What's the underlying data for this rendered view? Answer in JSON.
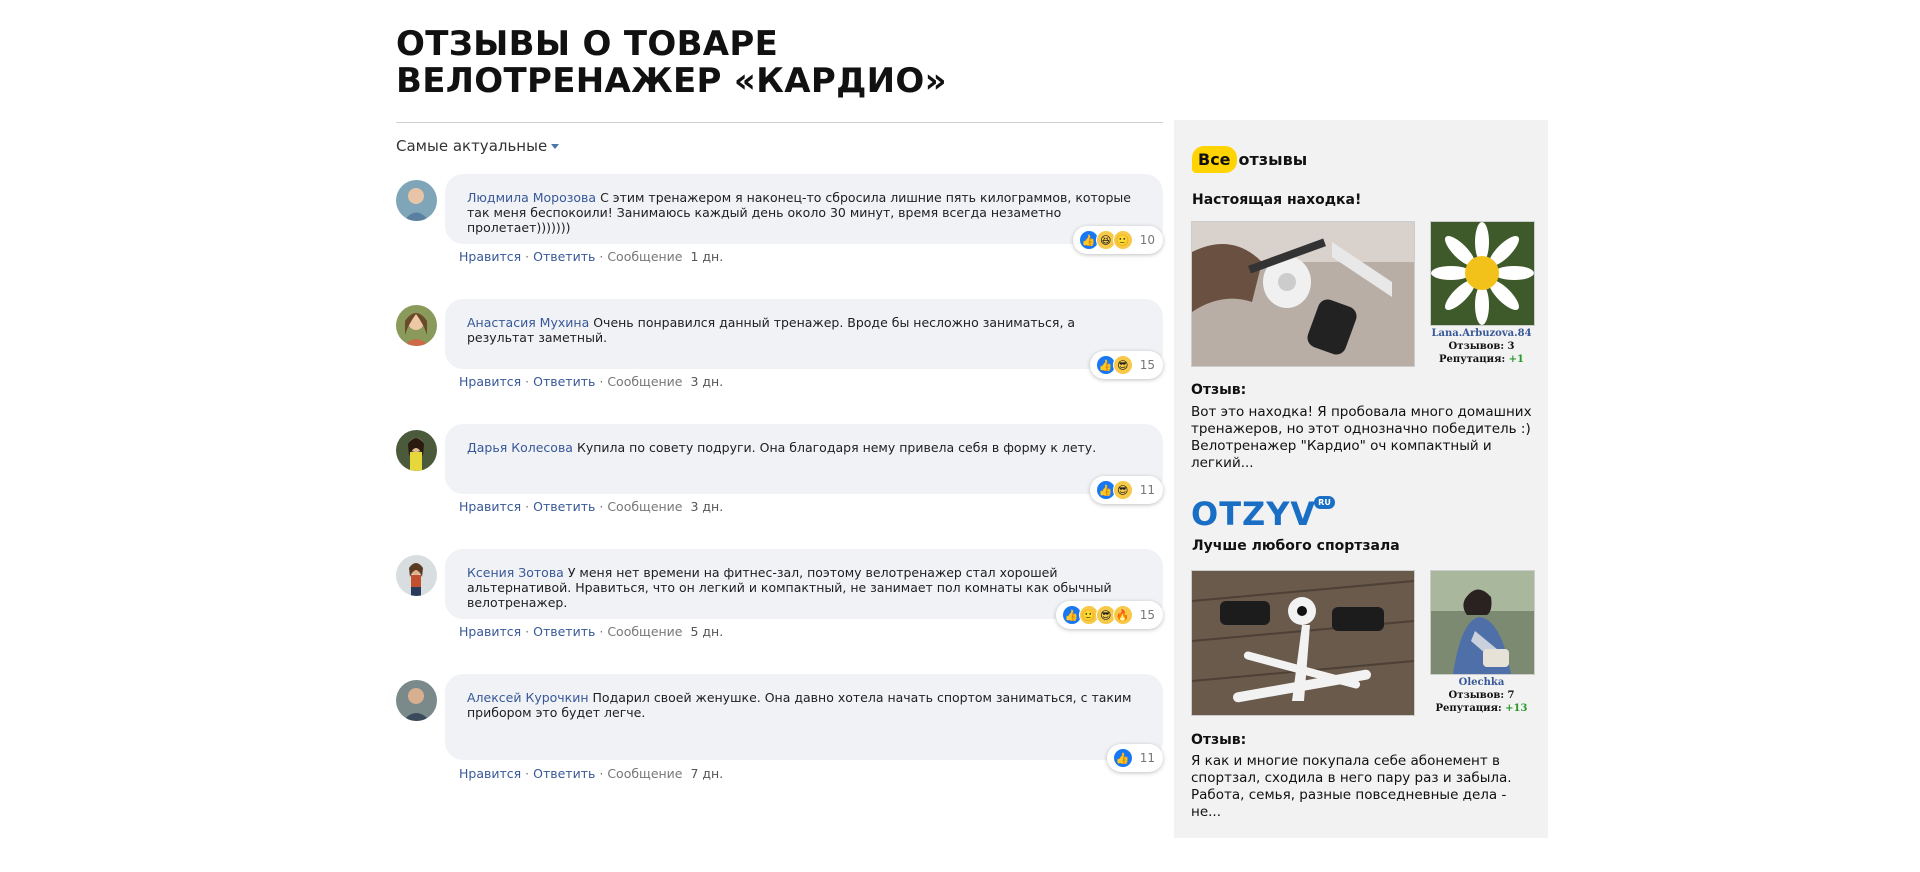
{
  "page": {
    "title_line1": "ОТЗЫВЫ О ТОВАРЕ",
    "title_line2": "ВЕЛОТРЕНАЖЕР «КАРДИО»",
    "sort_label": "Самые актуальные"
  },
  "actions": {
    "like": "Нравится",
    "reply": "Ответить",
    "message": "Сообщение",
    "sep": "·"
  },
  "comments": [
    {
      "author": "Людмила Морозова",
      "text": "С этим тренажером я наконец-то сбросила лишние пять килограммов, которые так меня беспокоили! Занимаюсь каждый день около 30 минут, время всегда незаметно пролетает)))))))",
      "count": "10",
      "time": "1 дн.",
      "reactions": [
        "like-icon",
        "laugh-icon",
        "smile-icon"
      ]
    },
    {
      "author": "Анастасия Мухина",
      "text": "Очень понравился данный тренажер. Вроде бы несложно заниматься, а результат заметный.",
      "count": "15",
      "time": "3 дн.",
      "reactions": [
        "like-icon",
        "cool-icon"
      ]
    },
    {
      "author": "Дарья Колесова",
      "text": "Купила по совету подруги. Она благодаря нему привела себя в форму к лету.",
      "count": "11",
      "time": "3 дн.",
      "reactions": [
        "like-icon",
        "cool-icon"
      ]
    },
    {
      "author": "Ксения Зотова",
      "text": "У меня нет времени на фитнес-зал, поэтому велотренажер стал хорошей альтернативой. Нравиться, что он легкий и компактный, не занимает пол комнаты как обычный велотренажер.",
      "count": "15",
      "time": "5 дн.",
      "reactions": [
        "like-icon",
        "smile-icon",
        "cool-icon",
        "fire-icon"
      ]
    },
    {
      "author": "Алексей Курочкин",
      "text": "Подарил своей женушке. Она давно хотела начать спортом заниматься, с таким прибором это будет легче.",
      "count": "11",
      "time": "7 дн.",
      "reactions": [
        "like-icon"
      ]
    }
  ],
  "sidebar": {
    "vse_logo_badge": "Все",
    "vse_logo_rest": "отзывы",
    "review1": {
      "title": "Настоящая находка!",
      "user": "Lana.Arbuzova.84",
      "reviews_label": "Отзывов:",
      "reviews_count": "3",
      "rep_label": "Репутация:",
      "rep_value": "+1",
      "label": "Отзыв:",
      "text": "Вот это находка! Я пробовала много домашних тренажеров, но этот однозначно победитель :) Велотренажер \"Кардио\" оч компактный и легкий..."
    },
    "otzyv_logo": "OTZYV",
    "otzyv_logo_ru": "RU",
    "review2": {
      "title": "Лучше любого спортзала",
      "user": "Olechka",
      "reviews_label": "Отзывов:",
      "reviews_count": "7",
      "rep_label": "Репутация:",
      "rep_value": "+13",
      "label": "Отзыв:",
      "text": "Я как и многие покупала себе абонемент в спортзал, сходила в него пару раз и забыла. Работа, семья, разные повседневные дела - не..."
    }
  }
}
